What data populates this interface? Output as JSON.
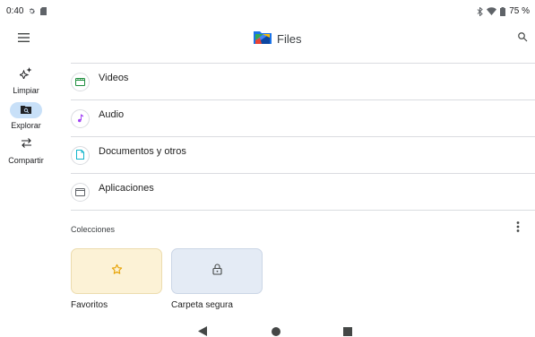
{
  "status_bar": {
    "time": "0:40",
    "battery": "75 %"
  },
  "app_bar": {
    "title": "Files",
    "menu_icon": "menu-icon",
    "search_icon": "search-icon"
  },
  "rail": [
    {
      "label": "Limpiar",
      "icon": "sparkle-icon",
      "active": false
    },
    {
      "label": "Explorar",
      "icon": "explore-folder-icon",
      "active": true
    },
    {
      "label": "Compartir",
      "icon": "swap-arrows-icon",
      "active": false
    }
  ],
  "categories": [
    {
      "label": "Videos",
      "icon": "video-icon",
      "color": "#1e8e3e"
    },
    {
      "label": "Audio",
      "icon": "music-note-icon",
      "color": "#a142f4"
    },
    {
      "label": "Documentos y otros",
      "icon": "document-icon",
      "color": "#12b5cb"
    },
    {
      "label": "Aplicaciones",
      "icon": "apps-icon",
      "color": "#5f6368"
    }
  ],
  "collections": {
    "header": "Colecciones",
    "items": [
      {
        "label": "Favoritos",
        "icon": "star-icon",
        "color": "#e6a100"
      },
      {
        "label": "Carpeta segura",
        "icon": "lock-icon",
        "color": "#444746"
      }
    ]
  },
  "colors": {
    "accent": "#c8e0f8",
    "favorites_bg": "#fcf2d6",
    "safe_folder_bg": "#e4ebf5"
  }
}
